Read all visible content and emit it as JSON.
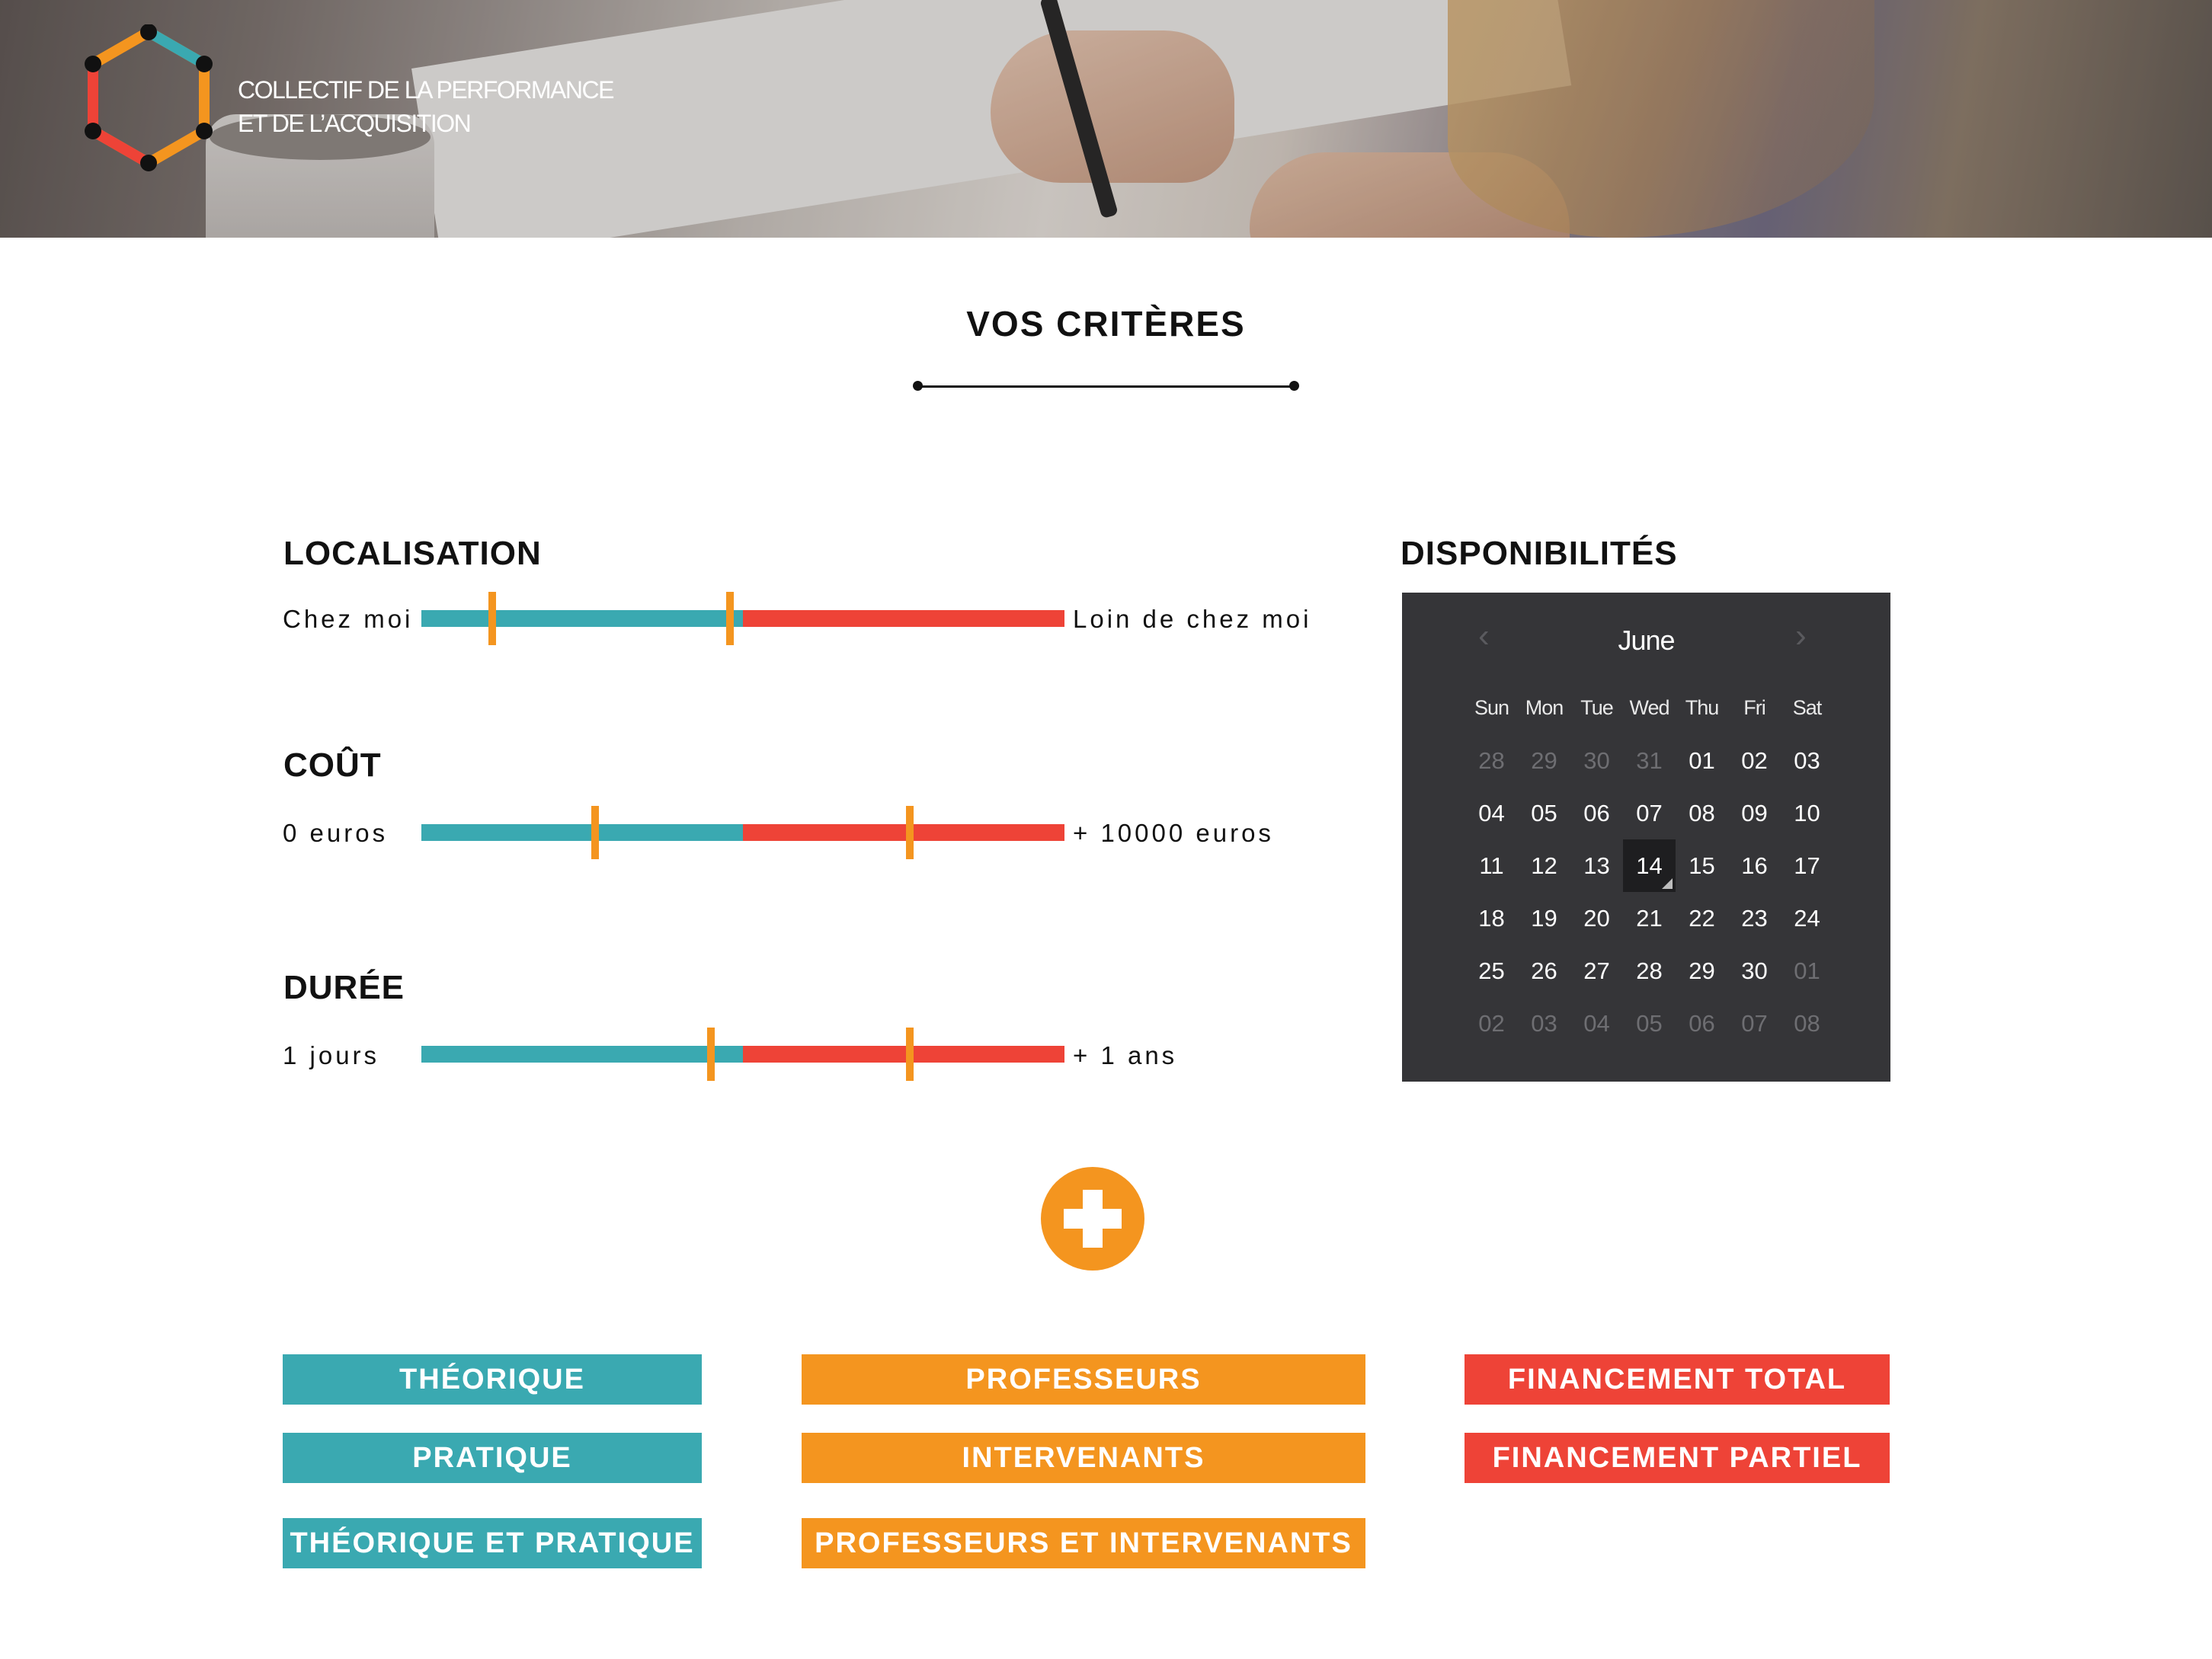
{
  "header": {
    "brand_line1": "COLLECTIF DE LA PERFORMANCE",
    "brand_line2": "ET DE L’ACQUISITION"
  },
  "page_title": "VOS CRITÈRES",
  "criteria": [
    {
      "title": "LOCALISATION",
      "min_label": "Chez moi",
      "max_label": "Loin de chez moi",
      "handles": [
        0.11,
        0.48
      ],
      "split": 0.5
    },
    {
      "title": "COÛT",
      "min_label": "0 euros",
      "max_label": "+ 10000 euros",
      "handles": [
        0.27,
        0.76
      ],
      "split": 0.5
    },
    {
      "title": "DURÉE",
      "min_label": "1 jours",
      "max_label": "+ 1 ans",
      "handles": [
        0.45,
        0.76
      ],
      "split": 0.5
    }
  ],
  "availability": {
    "title": "DISPONIBILITÉS",
    "month": "June",
    "weekdays": [
      "Sun",
      "Mon",
      "Tue",
      "Wed",
      "Thu",
      "Fri",
      "Sat"
    ],
    "weeks": [
      [
        "28",
        "29",
        "30",
        "31",
        "01",
        "02",
        "03"
      ],
      [
        "04",
        "05",
        "06",
        "07",
        "08",
        "09",
        "10"
      ],
      [
        "11",
        "12",
        "13",
        "14",
        "15",
        "16",
        "17"
      ],
      [
        "18",
        "19",
        "20",
        "21",
        "22",
        "23",
        "24"
      ],
      [
        "25",
        "26",
        "27",
        "28",
        "29",
        "30",
        "01"
      ],
      [
        "02",
        "03",
        "04",
        "05",
        "06",
        "07",
        "08"
      ]
    ],
    "selected_day": "14"
  },
  "tags": {
    "theory": [
      "THÉORIQUE",
      "PRATIQUE",
      "THÉORIQUE ET PRATIQUE"
    ],
    "teachers": [
      "PROFESSEURS",
      "INTERVENANTS",
      "PROFESSEURS ET INTERVENANTS"
    ],
    "funding": [
      "FINANCEMENT TOTAL",
      "FINANCEMENT PARTIEL"
    ]
  },
  "colors": {
    "teal": "#3aa9b1",
    "orange": "#f4951f",
    "red": "#ee4337",
    "calendar_bg": "#353538"
  },
  "icons": [
    "hexagon-logo-icon",
    "chevron-left-icon",
    "chevron-right-icon",
    "plus-icon"
  ]
}
